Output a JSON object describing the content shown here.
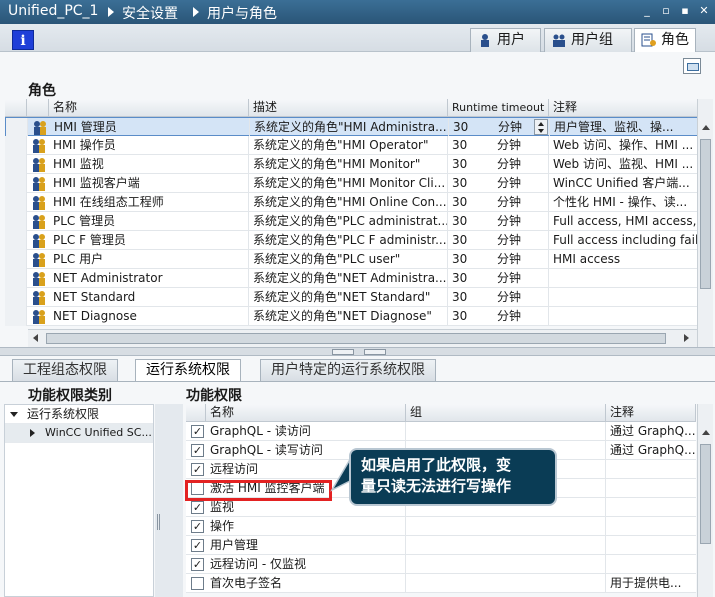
{
  "breadcrumb": {
    "project": "Unified_PC_1",
    "section": "安全设置",
    "page": "用户与角色"
  },
  "tabs": [
    {
      "label": "用户",
      "icon": "user-icon"
    },
    {
      "label": "用户组",
      "icon": "user-group-icon"
    },
    {
      "label": "角色",
      "icon": "role-icon"
    }
  ],
  "info_button": "i",
  "roles_section": {
    "title": "角色"
  },
  "roles_columns": [
    "名称",
    "描述",
    "Runtime timeout",
    "注释"
  ],
  "roles": [
    {
      "name": "HMI 管理员",
      "desc": "系统定义的角色\"HMI Administra...",
      "timeout": "30",
      "unit": "分钟",
      "comment": "用户管理、监视、操..."
    },
    {
      "name": "HMI 操作员",
      "desc": "系统定义的角色\"HMI Operator\"",
      "timeout": "30",
      "unit": "分钟",
      "comment": "Web 访问、操作、HMI ..."
    },
    {
      "name": "HMI 监视",
      "desc": "系统定义的角色\"HMI Monitor\"",
      "timeout": "30",
      "unit": "分钟",
      "comment": "Web 访问、监视、HMI ..."
    },
    {
      "name": "HMI 监视客户端",
      "desc": "系统定义的角色\"HMI Monitor Cli...",
      "timeout": "30",
      "unit": "分钟",
      "comment": "WinCC Unified 客户端..."
    },
    {
      "name": "HMI 在线组态工程师",
      "desc": "系统定义的角色\"HMI Online Con...",
      "timeout": "30",
      "unit": "分钟",
      "comment": "个性化 HMI - 操作、读..."
    },
    {
      "name": "PLC 管理员",
      "desc": "系统定义的角色\"PLC administrat...",
      "timeout": "30",
      "unit": "分钟",
      "comment": "Full access, HMI access, ..."
    },
    {
      "name": "PLC F 管理员",
      "desc": "系统定义的角色\"PLC F administr...",
      "timeout": "30",
      "unit": "分钟",
      "comment": "Full access including fail..."
    },
    {
      "name": "PLC 用户",
      "desc": "系统定义的角色\"PLC user\"",
      "timeout": "30",
      "unit": "分钟",
      "comment": "HMI access"
    },
    {
      "name": "NET Administrator",
      "desc": "系统定义的角色\"NET Administra...",
      "timeout": "30",
      "unit": "分钟",
      "comment": ""
    },
    {
      "name": "NET Standard",
      "desc": "系统定义的角色\"NET Standard\"",
      "timeout": "30",
      "unit": "分钟",
      "comment": ""
    },
    {
      "name": "NET Diagnose",
      "desc": "系统定义的角色\"NET Diagnose\"",
      "timeout": "30",
      "unit": "分钟",
      "comment": ""
    }
  ],
  "bottom_tabs": [
    "工程组态权限",
    "运行系统权限",
    "用户特定的运行系统权限"
  ],
  "left_title": "功能权限类别",
  "tree": [
    "运行系统权限",
    "WinCC Unified SC..."
  ],
  "right_title": "功能权限",
  "perm_columns": [
    "名称",
    "组",
    "注释"
  ],
  "permissions": [
    {
      "name": "GraphQL - 读访问",
      "checked": true,
      "comment": "通过 GraphQ..."
    },
    {
      "name": "GraphQL - 读写访问",
      "checked": true,
      "comment": "通过 GraphQ..."
    },
    {
      "name": "远程访问",
      "checked": true,
      "comment": ""
    },
    {
      "name": "激活 HMI 监控客户端",
      "checked": false,
      "comment": ""
    },
    {
      "name": "监视",
      "checked": true,
      "comment": ""
    },
    {
      "name": "操作",
      "checked": true,
      "comment": ""
    },
    {
      "name": "用户管理",
      "checked": true,
      "comment": ""
    },
    {
      "name": "远程访问 - 仅监视",
      "checked": true,
      "comment": ""
    },
    {
      "name": "首次电子签名",
      "checked": false,
      "comment": "用于提供电..."
    }
  ],
  "callout": {
    "line1": "如果启用了此权限，变",
    "line2": "量只读无法进行写操作"
  }
}
